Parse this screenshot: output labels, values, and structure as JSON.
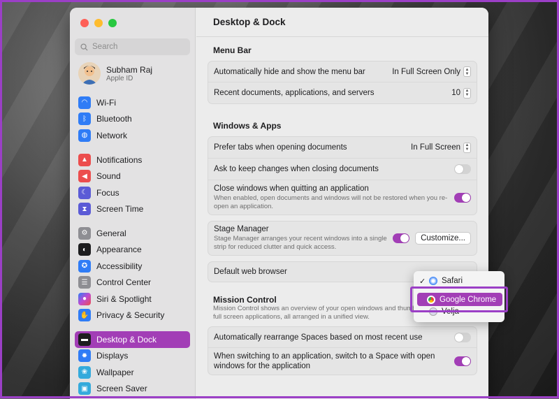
{
  "window_title": "Desktop & Dock",
  "search": {
    "placeholder": "Search"
  },
  "account": {
    "name": "Subham Raj",
    "subtitle": "Apple ID"
  },
  "sidebar": {
    "group1": [
      {
        "label": "Wi-Fi",
        "icon": "wifi-icon",
        "color": "#2f7cf6"
      },
      {
        "label": "Bluetooth",
        "icon": "bluetooth-icon",
        "color": "#2f7cf6"
      },
      {
        "label": "Network",
        "icon": "globe-icon",
        "color": "#2f7cf6"
      }
    ],
    "group2": [
      {
        "label": "Notifications",
        "icon": "bell-icon",
        "color": "#ec4d4d"
      },
      {
        "label": "Sound",
        "icon": "speaker-icon",
        "color": "#ec4d4d"
      },
      {
        "label": "Focus",
        "icon": "moon-icon",
        "color": "#5b5bd6"
      },
      {
        "label": "Screen Time",
        "icon": "hourglass-icon",
        "color": "#5b5bd6"
      }
    ],
    "group3": [
      {
        "label": "General",
        "icon": "gear-icon",
        "color": "#8e8e93"
      },
      {
        "label": "Appearance",
        "icon": "appearance-icon",
        "color": "#1d1d1f"
      },
      {
        "label": "Accessibility",
        "icon": "accessibility-icon",
        "color": "#2f7cf6"
      },
      {
        "label": "Control Center",
        "icon": "control-center-icon",
        "color": "#8e8e93"
      },
      {
        "label": "Siri & Spotlight",
        "icon": "siri-icon",
        "color": "#c04bd0"
      },
      {
        "label": "Privacy & Security",
        "icon": "hand-icon",
        "color": "#2f7cf6"
      }
    ],
    "group4": [
      {
        "label": "Desktop & Dock",
        "icon": "dock-icon",
        "color": "#1d1d1f",
        "selected": true
      },
      {
        "label": "Displays",
        "icon": "display-icon",
        "color": "#2f7cf6"
      },
      {
        "label": "Wallpaper",
        "icon": "wallpaper-icon",
        "color": "#34aadc"
      },
      {
        "label": "Screen Saver",
        "icon": "screensaver-icon",
        "color": "#34aadc"
      }
    ]
  },
  "sections": {
    "menu_bar": {
      "title": "Menu Bar",
      "rows": [
        {
          "label": "Automatically hide and show the menu bar",
          "value": "In Full Screen Only"
        },
        {
          "label": "Recent documents, applications, and servers",
          "value": "10"
        }
      ]
    },
    "windows_apps": {
      "title": "Windows & Apps",
      "prefer_tabs": {
        "label": "Prefer tabs when opening documents",
        "value": "In Full Screen"
      },
      "ask_keep": {
        "label": "Ask to keep changes when closing documents",
        "on": false
      },
      "close_windows": {
        "label": "Close windows when quitting an application",
        "desc": "When enabled, open documents and windows will not be restored when you re-open an application.",
        "on": true
      },
      "stage_manager": {
        "label": "Stage Manager",
        "desc": "Stage Manager arranges your recent windows into a single strip for reduced clutter and quick access.",
        "on": true,
        "button": "Customize..."
      },
      "default_browser": {
        "label": "Default web browser"
      }
    },
    "mission_control": {
      "title": "Mission Control",
      "desc": "Mission Control shows an overview of your open windows and thumbnails of full screen applications, all arranged in a unified view.",
      "rearrange": {
        "label": "Automatically rearrange Spaces based on most recent use",
        "on": false
      },
      "switch_space": {
        "label": "When switching to an application, switch to a Space with open windows for the application",
        "on": true
      }
    }
  },
  "browser_menu": {
    "items": [
      "Safari",
      "Google Chrome",
      "Velja"
    ],
    "checked": "Safari",
    "highlighted": "Google Chrome"
  },
  "colors": {
    "accent": "#a23eb6",
    "highlight_border": "#9b3fc6"
  }
}
